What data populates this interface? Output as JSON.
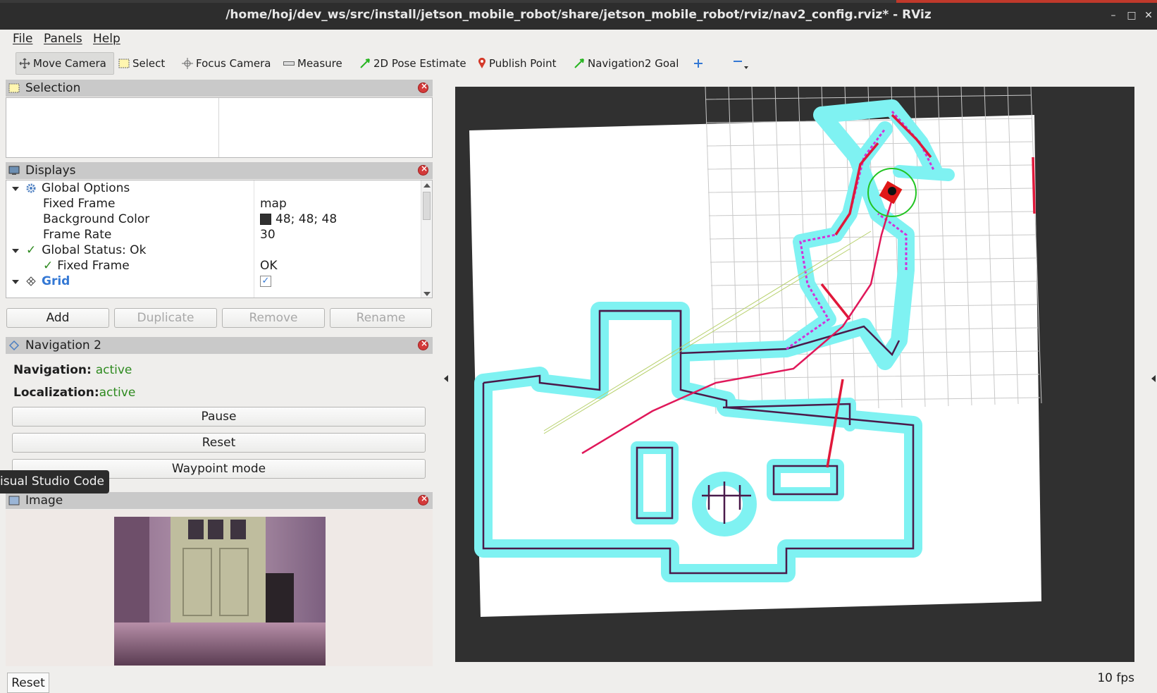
{
  "window": {
    "title": "/home/hoj/dev_ws/src/install/jetson_mobile_robot/share/jetson_mobile_robot/rviz/nav2_config.rviz* - RViz"
  },
  "menu": [
    "File",
    "Panels",
    "Help"
  ],
  "toolbar": {
    "tools": [
      "Move Camera",
      "Select",
      "Focus Camera",
      "Measure",
      "2D Pose Estimate",
      "Publish Point",
      "Navigation2 Goal"
    ]
  },
  "selection_panel": {
    "title": "Selection"
  },
  "displays_panel": {
    "title": "Displays",
    "rows": [
      {
        "label": "Global Options",
        "value": ""
      },
      {
        "label": "Fixed Frame",
        "value": "map"
      },
      {
        "label": "Background Color",
        "value": "48; 48; 48"
      },
      {
        "label": "Frame Rate",
        "value": "30"
      },
      {
        "label": "Global Status: Ok",
        "value": ""
      },
      {
        "label": "Fixed Frame",
        "value": "OK"
      },
      {
        "label": "Grid",
        "value": ""
      }
    ],
    "background_color_swatch": "#303030",
    "buttons": {
      "add": "Add",
      "duplicate": "Duplicate",
      "remove": "Remove",
      "rename": "Rename"
    }
  },
  "nav2_panel": {
    "title": "Navigation 2",
    "navigation_label": "Navigation:",
    "navigation_status": "active",
    "localization_label": "Localization:",
    "localization_status": "active",
    "buttons": {
      "pause": "Pause",
      "reset": "Reset",
      "waypoint": "Waypoint mode"
    }
  },
  "tooltip": "isual Studio Code",
  "image_panel": {
    "title": "Image"
  },
  "bottom": {
    "reset": "Reset",
    "fps": "10 fps"
  },
  "colors": {
    "accent": "#3478d4",
    "status_ok": "#2e8a1f",
    "costmap": "#7ff2f2",
    "path": "#e0185a"
  }
}
